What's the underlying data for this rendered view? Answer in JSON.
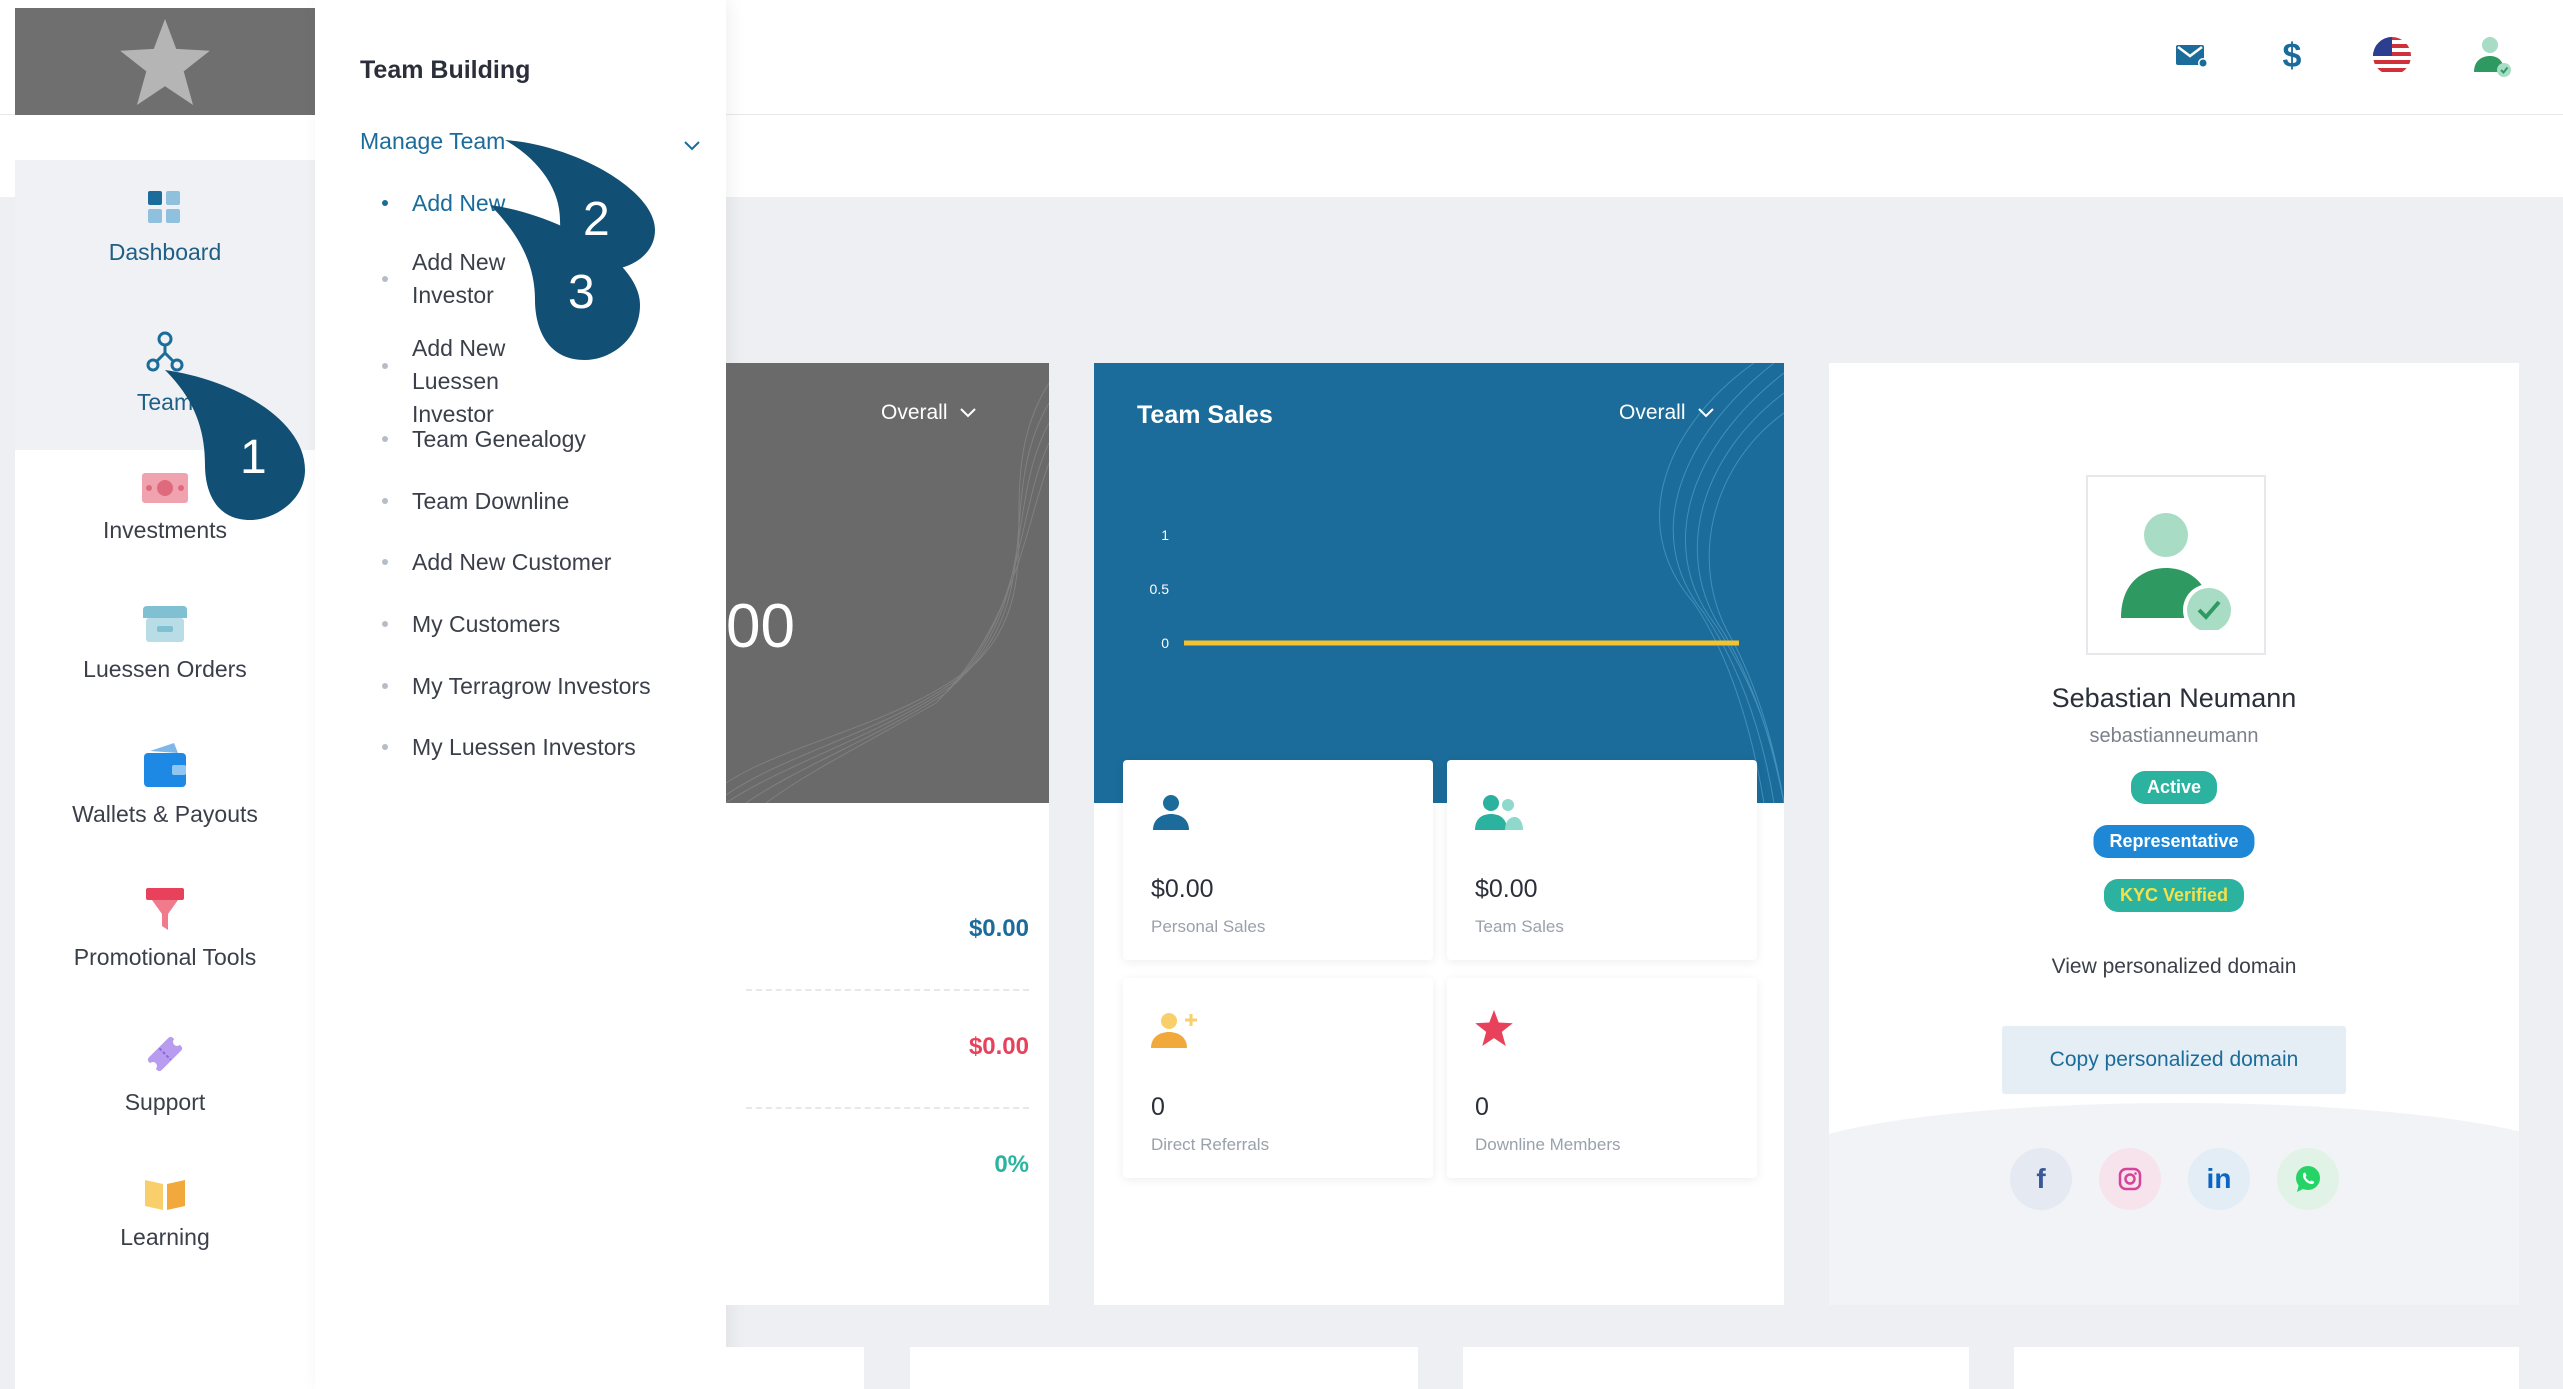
{
  "topbar": {
    "icons": [
      "mail-icon",
      "dollar-icon",
      "us-flag-icon",
      "user-verified-icon"
    ],
    "dollar_glyph": "$"
  },
  "rail": {
    "items": [
      {
        "label": "Dashboard",
        "icon": "dashboard-icon"
      },
      {
        "label": "Team",
        "icon": "team-icon",
        "active": true
      },
      {
        "label": "Investments",
        "icon": "money-icon"
      },
      {
        "label": "Luessen Orders",
        "icon": "store-icon"
      },
      {
        "label": "Wallets & Payouts",
        "icon": "wallet-icon"
      },
      {
        "label": "Promotional Tools",
        "icon": "funnel-icon"
      },
      {
        "label": "Support",
        "icon": "ticket-icon"
      },
      {
        "label": "Learning",
        "icon": "book-icon"
      }
    ]
  },
  "submenu": {
    "title": "Team Building",
    "group_label": "Manage Team",
    "items": [
      {
        "label": "Add New",
        "active": true
      },
      {
        "label": "Add New Investor"
      },
      {
        "label": "Add New Luessen Investor"
      },
      {
        "label": "Team Genealogy"
      },
      {
        "label": "Team Downline"
      },
      {
        "label": "Add New Customer"
      },
      {
        "label": "My Customers"
      },
      {
        "label": "My Terragrow Investors"
      },
      {
        "label": "My Luessen Investors"
      }
    ]
  },
  "left_card": {
    "overall_label": "Overall",
    "big_value": "00",
    "rows": [
      {
        "value": "$0.00",
        "color": "#1b6c9a"
      },
      {
        "value": "$0.00",
        "color": "#e8415b"
      },
      {
        "value": "0%",
        "color": "#2bb3a0"
      }
    ]
  },
  "team_sales": {
    "title": "Team Sales",
    "overall_label": "Overall",
    "stats": [
      {
        "value": "$0.00",
        "label": "Personal Sales",
        "icon": "person-icon"
      },
      {
        "value": "$0.00",
        "label": "Team Sales",
        "icon": "group-icon"
      },
      {
        "value": "0",
        "label": "Direct Referrals",
        "icon": "add-person-icon"
      },
      {
        "value": "0",
        "label": "Downline Members",
        "icon": "star-icon"
      }
    ]
  },
  "chart_data": {
    "type": "line",
    "title": "Team Sales",
    "yticks": [
      "1",
      "0.5",
      "0"
    ],
    "ylim": [
      0,
      1
    ],
    "series": [
      {
        "values": [
          0,
          0
        ]
      }
    ],
    "line_color": "#f2c230"
  },
  "profile": {
    "name": "Sebastian Neumann",
    "username": "sebastianneumann",
    "badges": [
      {
        "label": "Active",
        "color": "#2bb3a0"
      },
      {
        "label": "Representative",
        "color": "#1e88d6"
      },
      {
        "label": "KYC Verified",
        "color": "#2bb3a0",
        "text_color": "#f5e04a"
      }
    ],
    "view_domain": "View personalized domain",
    "copy_domain": "Copy personalized domain",
    "social": [
      {
        "name": "facebook-icon",
        "glyph": "f"
      },
      {
        "name": "instagram-icon",
        "glyph": ""
      },
      {
        "name": "linkedin-icon",
        "glyph": "in"
      },
      {
        "name": "whatsapp-icon",
        "glyph": ""
      }
    ]
  },
  "callouts": [
    "1",
    "2",
    "3"
  ]
}
